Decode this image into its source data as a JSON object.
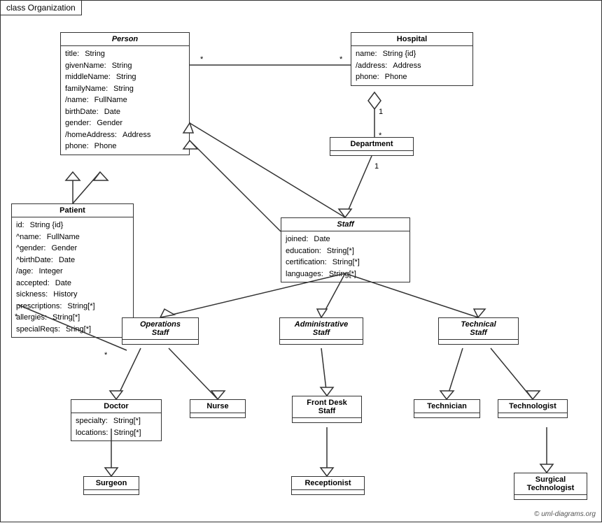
{
  "title": "class Organization",
  "copyright": "© uml-diagrams.org",
  "classes": {
    "person": {
      "name": "Person",
      "italic": true,
      "attrs": [
        {
          "name": "title:",
          "type": "String"
        },
        {
          "name": "givenName:",
          "type": "String"
        },
        {
          "name": "middleName:",
          "type": "String"
        },
        {
          "name": "familyName:",
          "type": "String"
        },
        {
          "name": "/name:",
          "type": "FullName"
        },
        {
          "name": "birthDate:",
          "type": "Date"
        },
        {
          "name": "gender:",
          "type": "Gender"
        },
        {
          "name": "/homeAddress:",
          "type": "Address"
        },
        {
          "name": "phone:",
          "type": "Phone"
        }
      ]
    },
    "hospital": {
      "name": "Hospital",
      "italic": false,
      "attrs": [
        {
          "name": "name:",
          "type": "String {id}"
        },
        {
          "name": "/address:",
          "type": "Address"
        },
        {
          "name": "phone:",
          "type": "Phone"
        }
      ]
    },
    "patient": {
      "name": "Patient",
      "italic": false,
      "attrs": [
        {
          "name": "id:",
          "type": "String {id}"
        },
        {
          "name": "^name:",
          "type": "FullName"
        },
        {
          "name": "^gender:",
          "type": "Gender"
        },
        {
          "name": "^birthDate:",
          "type": "Date"
        },
        {
          "name": "/age:",
          "type": "Integer"
        },
        {
          "name": "accepted:",
          "type": "Date"
        },
        {
          "name": "sickness:",
          "type": "History"
        },
        {
          "name": "prescriptions:",
          "type": "String[*]"
        },
        {
          "name": "allergies:",
          "type": "String[*]"
        },
        {
          "name": "specialReqs:",
          "type": "Sring[*]"
        }
      ]
    },
    "department": {
      "name": "Department",
      "italic": false,
      "attrs": []
    },
    "staff": {
      "name": "Staff",
      "italic": true,
      "attrs": [
        {
          "name": "joined:",
          "type": "Date"
        },
        {
          "name": "education:",
          "type": "String[*]"
        },
        {
          "name": "certification:",
          "type": "String[*]"
        },
        {
          "name": "languages:",
          "type": "String[*]"
        }
      ]
    },
    "operations_staff": {
      "name": "Operations\nStaff",
      "italic": true,
      "attrs": []
    },
    "administrative_staff": {
      "name": "Administrative\nStaff",
      "italic": true,
      "attrs": []
    },
    "technical_staff": {
      "name": "Technical\nStaff",
      "italic": true,
      "attrs": []
    },
    "doctor": {
      "name": "Doctor",
      "italic": false,
      "attrs": [
        {
          "name": "specialty:",
          "type": "String[*]"
        },
        {
          "name": "locations:",
          "type": "String[*]"
        }
      ]
    },
    "nurse": {
      "name": "Nurse",
      "italic": false,
      "attrs": []
    },
    "front_desk_staff": {
      "name": "Front Desk\nStaff",
      "italic": false,
      "attrs": []
    },
    "technician": {
      "name": "Technician",
      "italic": false,
      "attrs": []
    },
    "technologist": {
      "name": "Technologist",
      "italic": false,
      "attrs": []
    },
    "surgeon": {
      "name": "Surgeon",
      "italic": false,
      "attrs": []
    },
    "receptionist": {
      "name": "Receptionist",
      "italic": false,
      "attrs": []
    },
    "surgical_technologist": {
      "name": "Surgical\nTechnologist",
      "italic": false,
      "attrs": []
    }
  },
  "labels": {
    "star1": "*",
    "star2": "*",
    "one1": "1",
    "one2": "1",
    "star3": "*",
    "star4": "*"
  }
}
